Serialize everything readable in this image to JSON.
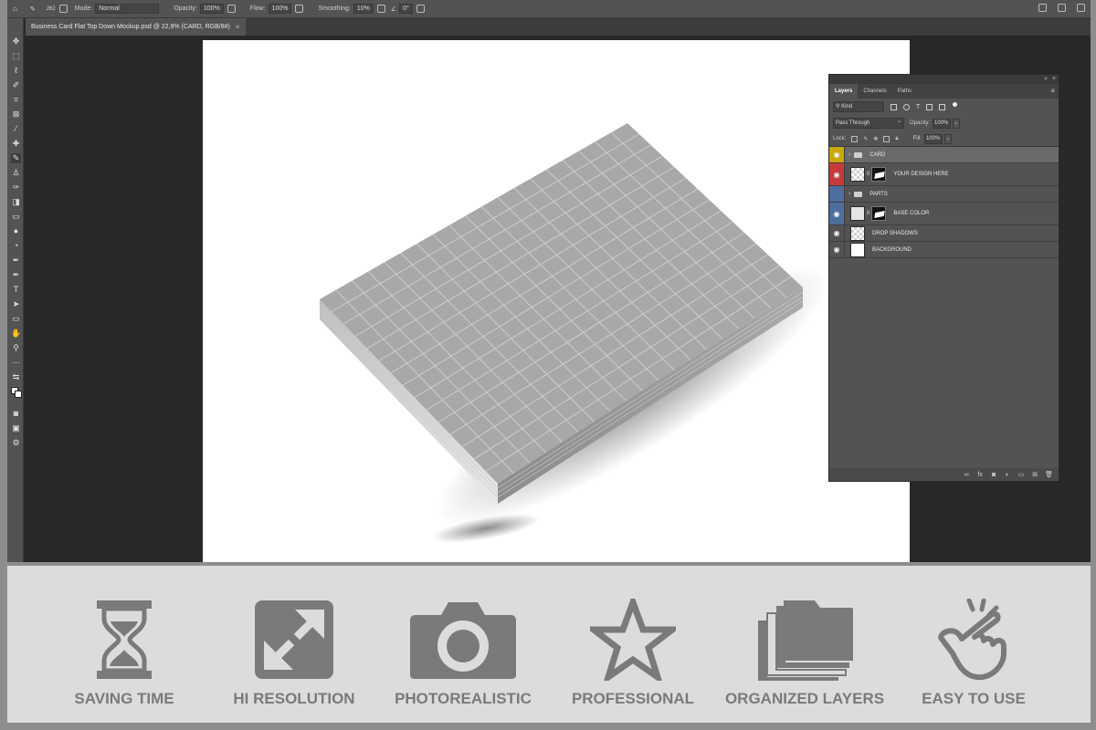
{
  "options_bar": {
    "brush_size": "262",
    "mode_label": "Mode:",
    "mode_value": "Normal",
    "opacity_label": "Opacity:",
    "opacity_value": "100%",
    "flow_label": "Flow:",
    "flow_value": "100%",
    "smoothing_label": "Smoothing:",
    "smoothing_value": "10%",
    "angle_value": "0°"
  },
  "document_tab": {
    "title": "Business Card Flat Top Down Mockup.psd @ 22,9% (CARD, RGB/8#)",
    "close": "×"
  },
  "layers_panel": {
    "tabs": [
      "Layers",
      "Channels",
      "Paths"
    ],
    "filter_kind": "Kind",
    "blend_mode": "Pass Through",
    "opacity_label": "Opacity:",
    "opacity_value": "100%",
    "lock_label": "Lock:",
    "fill_label": "Fill:",
    "fill_value": "100%",
    "layers": [
      {
        "name": "CARD",
        "type": "group",
        "eye_color": "#c9a800",
        "selected": true
      },
      {
        "name": "YOUR DESIGN HERE",
        "type": "smart",
        "eye_color": "#c73a3a",
        "selected": false
      },
      {
        "name": "PARTS",
        "type": "group",
        "eye_color": "#4d6e9e",
        "selected": false
      },
      {
        "name": "BASE COLOR",
        "type": "masked",
        "eye_color": "#4d6e9e",
        "selected": false
      },
      {
        "name": "DROP SHADOWS",
        "type": "transparent",
        "eye_color": "",
        "selected": false
      },
      {
        "name": "BACKGROUND",
        "type": "white",
        "eye_color": "",
        "selected": false
      }
    ]
  },
  "features": [
    {
      "label": "SAVING TIME",
      "icon": "hourglass-icon"
    },
    {
      "label": "HI RESOLUTION",
      "icon": "expand-icon"
    },
    {
      "label": "PHOTOREALISTIC",
      "icon": "camera-icon"
    },
    {
      "label": "PROFESSIONAL",
      "icon": "star-icon"
    },
    {
      "label": "ORGANIZED LAYERS",
      "icon": "layers-icon"
    },
    {
      "label": "EASY TO USE",
      "icon": "tap-hand-icon"
    }
  ],
  "colors": {
    "feature_icon": "#7a7a7a",
    "feature_label": "#7a7a7a",
    "ps_panel": "#535353",
    "ps_workspace": "#282828"
  }
}
